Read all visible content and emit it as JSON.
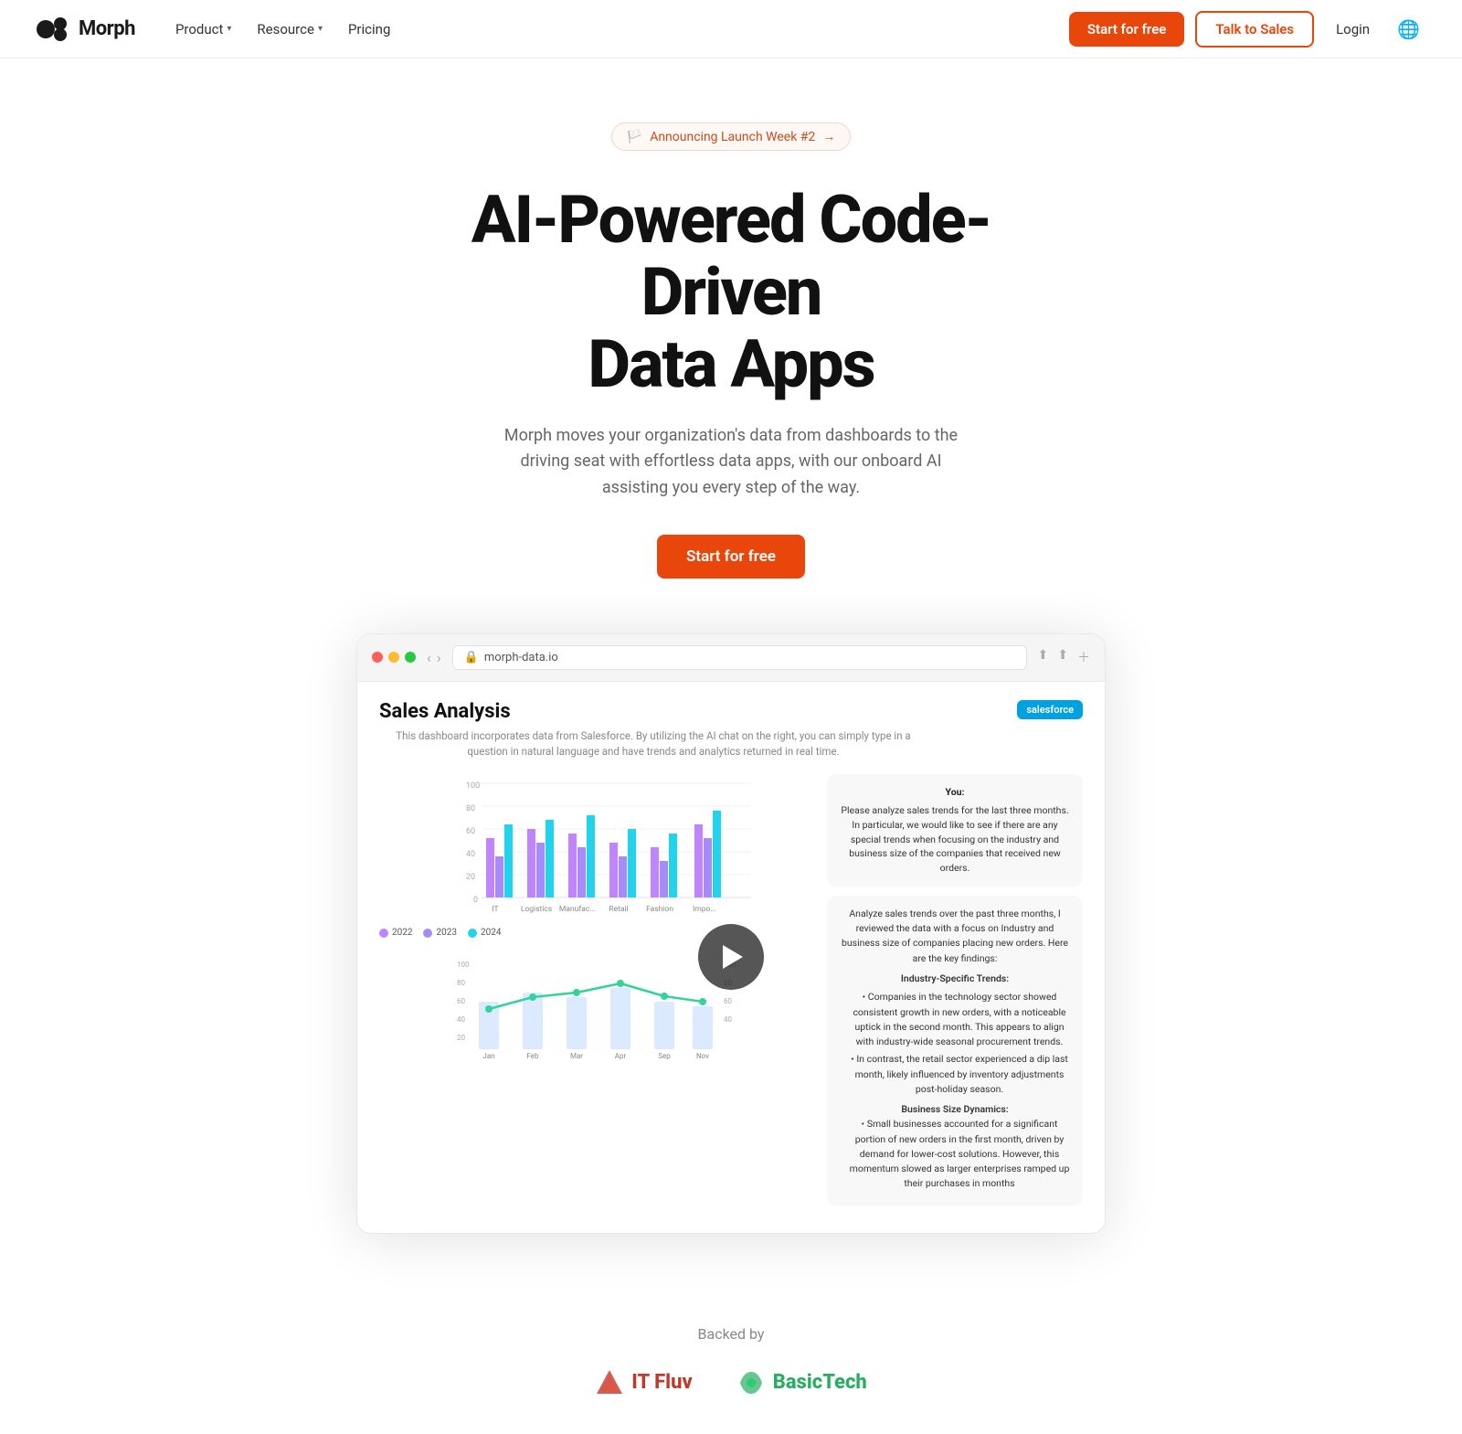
{
  "nav": {
    "brand": "Morph",
    "links": [
      {
        "label": "Product",
        "hasDropdown": true
      },
      {
        "label": "Resource",
        "hasDropdown": true
      },
      {
        "label": "Pricing",
        "hasDropdown": false
      }
    ],
    "cta_start": "Start for free",
    "cta_talk": "Talk to Sales",
    "cta_login": "Login"
  },
  "hero": {
    "badge_emoji": "🏳️",
    "badge_text": "Announcing Launch Week #2",
    "badge_arrow": "→",
    "title_line1": "AI-Powered Code-Driven",
    "title_line2": "Data Apps",
    "subtitle": "Morph moves your organization's data from dashboards to the driving seat with effortless data apps, with our onboard AI assisting you every step of the way.",
    "cta_label": "Start for free"
  },
  "browser": {
    "url": "morph-data.io",
    "dashboard_title": "Sales Analysis",
    "dashboard_desc": "This dashboard incorporates data from Salesforce. By utilizing the AI chat on the right, you can simply type in a question in natural language and have trends and analytics returned in real time.",
    "salesforce_label": "salesforce",
    "chart_legend": [
      "2022",
      "2023",
      "2024"
    ],
    "chart_categories": [
      "IT",
      "Logistics",
      "Manufac...",
      "Retail",
      "Fashion",
      "Impo..."
    ],
    "chat": {
      "you_label": "You:",
      "user_msg": "Please analyze sales trends for the last three months. In particular, we would like to see if there are any special trends when focusing on the industry and business size of the companies that received new orders.",
      "ai_intro": "Analyze sales trends over the past three months, I reviewed the data with a focus on Industry and business size of companies placing new orders. Here are the key findings:",
      "section1_title": "Industry-Specific Trends:",
      "bullets": [
        "Companies in the technology sector showed consistent growth in new orders, with a noticeable uptick in the second month. This appears to align with industry-wide seasonal procurement trends.",
        "In contrast, the retail sector experienced a dip last month, likely influenced by inventory adjustments post-holiday season.",
        "Business Size Dynamics:",
        "Small businesses accounted for a significant portion of new orders in the first month, driven by demand for lower-cost solutions. However, this momentum slowed as larger enterprises ramped up their purchases in months"
      ]
    }
  },
  "backed": {
    "label": "Backed by",
    "logos": [
      {
        "name": "IT Fluv",
        "prefix": "IT"
      },
      {
        "name": "BasicTech",
        "prefix": "Basic"
      }
    ]
  },
  "colors": {
    "accent": "#e8460a",
    "bar2022": "#c084fc",
    "bar2023": "#a78bfa",
    "bar2024": "#22d3ee",
    "line": "#34d399"
  }
}
